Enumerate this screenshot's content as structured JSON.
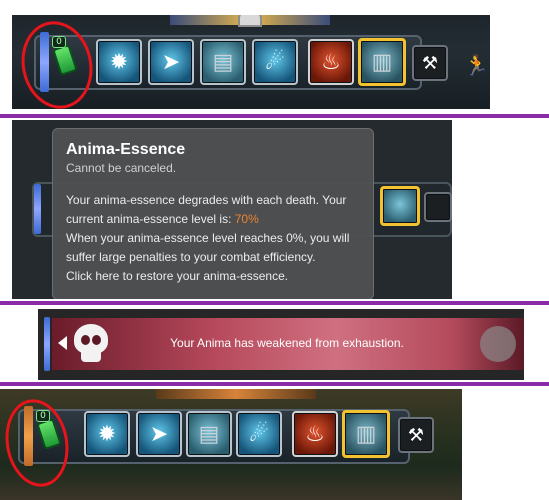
{
  "hotbar": {
    "anima_badge": "0",
    "slots": [
      {
        "icon": "gear-burst-icon",
        "glyph": "✹"
      },
      {
        "icon": "dash-arrows-icon",
        "glyph": "➤"
      },
      {
        "icon": "canister-icon",
        "glyph": "▤"
      },
      {
        "icon": "hand-cannon-icon",
        "glyph": "☄"
      },
      {
        "icon": "fire-target-icon",
        "glyph": "♨"
      },
      {
        "icon": "barrel-icon",
        "glyph": "▥"
      },
      {
        "icon": "drill-icon",
        "glyph": "⚒"
      }
    ],
    "sprint_icon": "🏃"
  },
  "tooltip": {
    "title": "Anima-Essence",
    "subtitle": "Cannot be canceled.",
    "line1": "Your anima-essence degrades with each death. Your",
    "line2_prefix": "current anima-essence level is: ",
    "level": "70%",
    "line3": "When your anima-essence level reaches 0%, you will",
    "line4": "suffer large penalties to your combat efficiency.",
    "line5": "Click here to restore your anima-essence."
  },
  "banner": {
    "message": "Your Anima has weakened from exhaustion."
  },
  "colors": {
    "divider": "#8a2ba8",
    "annotation_ring": "#e6141b",
    "level_text": "#f0832d",
    "selected_slot_border": "#f2c230"
  }
}
